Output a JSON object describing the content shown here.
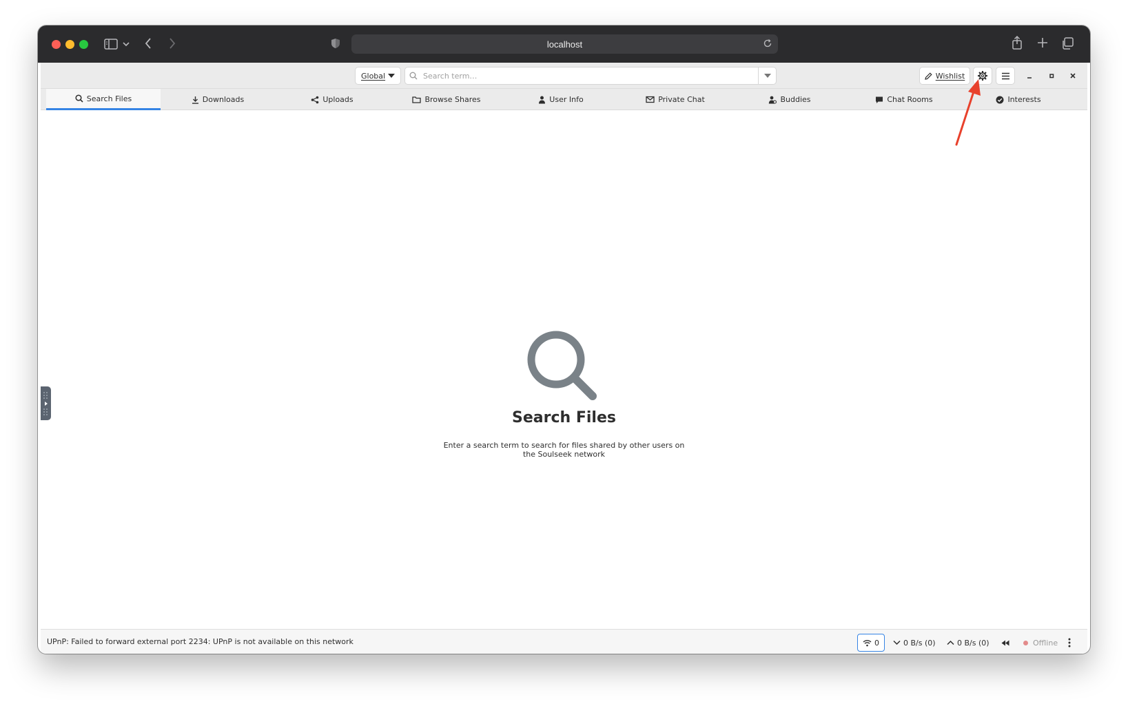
{
  "browser": {
    "url": "localhost"
  },
  "header": {
    "scope_label": "Global",
    "search_placeholder": "Search term…",
    "wishlist_label": "Wishlist"
  },
  "tabs": [
    {
      "label": "Search Files",
      "icon": "search-icon",
      "active": true
    },
    {
      "label": "Downloads",
      "icon": "download-icon"
    },
    {
      "label": "Uploads",
      "icon": "share-icon"
    },
    {
      "label": "Browse Shares",
      "icon": "folder-icon"
    },
    {
      "label": "User Info",
      "icon": "user-icon"
    },
    {
      "label": "Private Chat",
      "icon": "envelope-icon"
    },
    {
      "label": "Buddies",
      "icon": "buddies-icon"
    },
    {
      "label": "Chat Rooms",
      "icon": "chat-bubble-icon"
    },
    {
      "label": "Interests",
      "icon": "check-circle-icon"
    }
  ],
  "empty_state": {
    "title": "Search Files",
    "description": "Enter a search term to search for files shared by other users on the Soulseek network"
  },
  "statusbar": {
    "message": "UPnP: Failed to forward external port 2234: UPnP is not available on this network",
    "connections": "0",
    "download_speed": "0 B/s (0)",
    "upload_speed": "0 B/s (0)",
    "status": "Offline"
  },
  "colors": {
    "accent": "#3584e4",
    "annotation": "#e8412c",
    "offline_dot": "#e38b8b"
  }
}
